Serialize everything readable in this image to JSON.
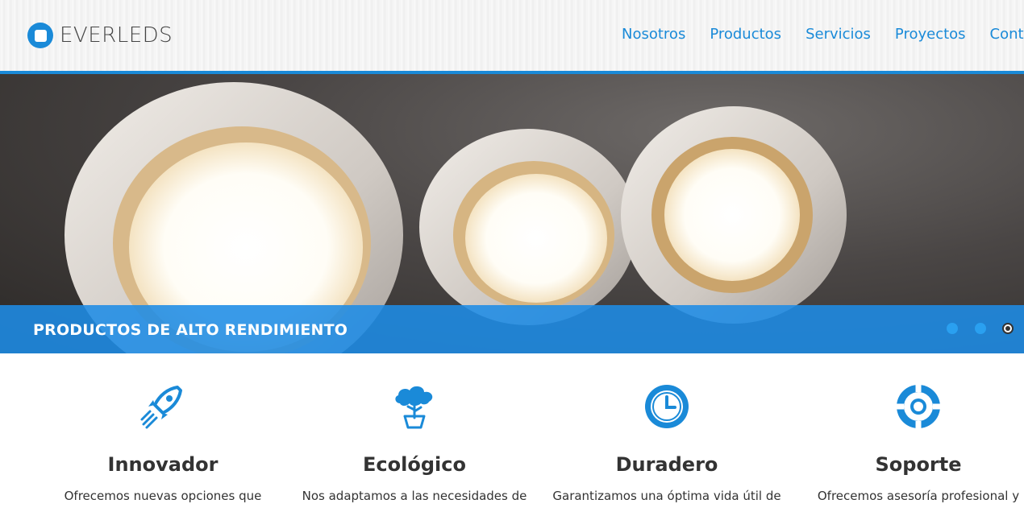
{
  "brand": {
    "name": "EVERLEDS"
  },
  "nav": {
    "items": [
      "Nosotros",
      "Productos",
      "Servicios",
      "Proyectos",
      "Contac"
    ]
  },
  "hero": {
    "caption": "PRODUCTOS DE ALTO RENDIMIENTO",
    "slide_count": 3,
    "active_slide": 3
  },
  "features": [
    {
      "icon": "rocket-icon",
      "title": "Innovador",
      "text": "Ofrecemos nuevas opciones que"
    },
    {
      "icon": "cloud-tree-icon",
      "title": "Ecológico",
      "text": "Nos adaptamos a las necesidades de"
    },
    {
      "icon": "clock-icon",
      "title": "Duradero",
      "text": "Garantizamos una óptima vida útil de"
    },
    {
      "icon": "lifebuoy-icon",
      "title": "Soporte",
      "text": "Ofrecemos asesoría profesional y"
    }
  ],
  "colors": {
    "accent": "#1a8ad8",
    "caption_bg": "#1e8ce6"
  }
}
